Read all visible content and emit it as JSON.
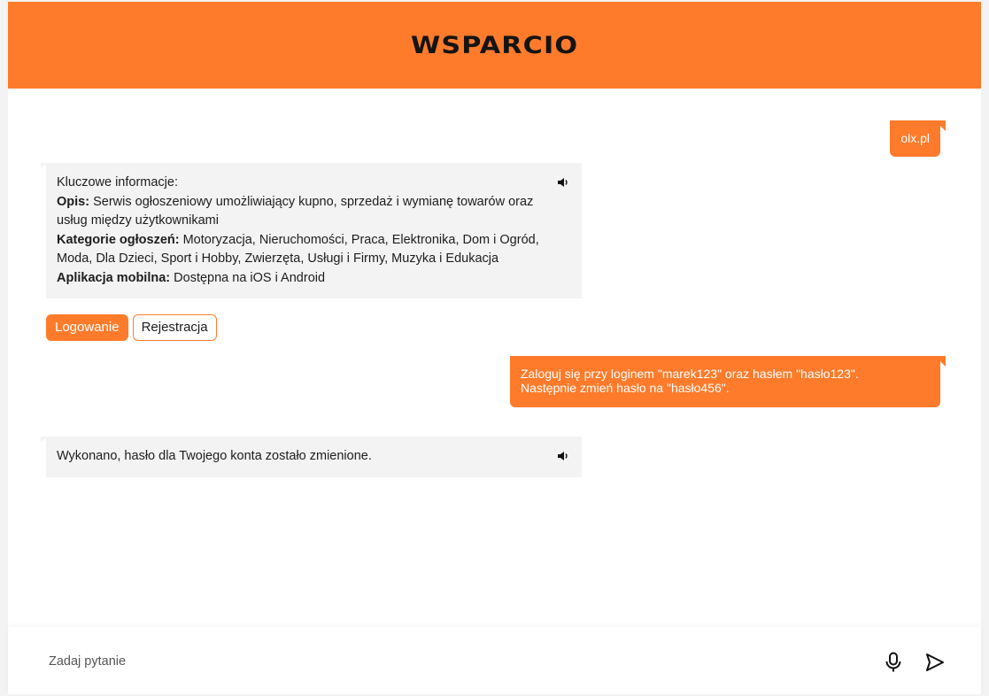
{
  "header": {
    "title": "WSPARCIO"
  },
  "messages": {
    "user1": "olx.pl",
    "bot1": {
      "intro": "Kluczowe informacje:",
      "opis_label": "Opis:",
      "opis_text": " Serwis ogłoszeniowy umożliwiający kupno, sprzedaż i wymianę towarów oraz usług między użytkownikami",
      "kategorie_label": "Kategorie ogłoszeń:",
      "kategorie_text": " Motoryzacja, Nieruchomości, Praca, Elektronika, Dom i Ogród, Moda, Dla Dzieci, Sport i Hobby, Zwierzęta, Usługi i Firmy, Muzyka i Edukacja",
      "aplikacja_label": "Aplikacja mobilna:",
      "aplikacja_text": " Dostępna na iOS i Android"
    },
    "user2_line1": "Zaloguj się przy loginem \"marek123\" oraz hasłem \"hasło123\".",
    "user2_line2": "Następnie zmień hasło na \"hasło456\".",
    "bot2": "Wykonano, hasło dla Twojego konta zostało zmienione."
  },
  "actions": {
    "login_label": "Logowanie",
    "register_label": "Rejestracja"
  },
  "input": {
    "placeholder": "Zadaj pytanie",
    "value": ""
  },
  "icons": {
    "speaker": "speaker-icon",
    "mic": "microphone-icon",
    "send": "send-icon"
  },
  "colors": {
    "accent": "#fe7b2b",
    "bot_bubble": "#f3f3f3",
    "title": "#141414"
  }
}
